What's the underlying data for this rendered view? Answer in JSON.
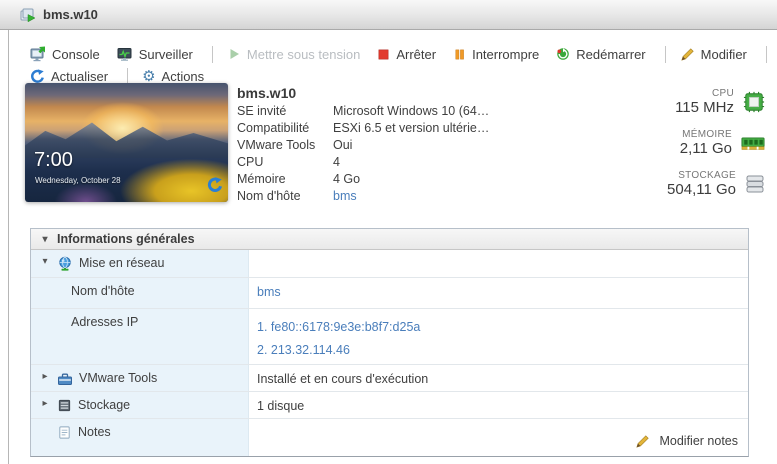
{
  "titlebar": {
    "title": "bms.w10"
  },
  "toolbar": {
    "console": "Console",
    "surveiller": "Surveiller",
    "mettre_sous_tension": "Mettre sous tension",
    "arreter": "Arrêter",
    "interrompre": "Interrompre",
    "redemarrer": "Redémarrer",
    "modifier": "Modifier",
    "actualiser": "Actualiser",
    "actions": "Actions"
  },
  "vm": {
    "name": "bms.w10",
    "thumbnail": {
      "time": "7:00",
      "date": "Wednesday, October 28"
    },
    "details": [
      {
        "label": "SE invité",
        "value": "Microsoft Windows 10 (64…"
      },
      {
        "label": "Compatibilité",
        "value": "ESXi 6.5 et version ultérie…"
      },
      {
        "label": "VMware Tools",
        "value": "Oui"
      },
      {
        "label": "CPU",
        "value": "4"
      },
      {
        "label": "Mémoire",
        "value": "4 Go"
      },
      {
        "label": "Nom d'hôte",
        "value": "bms"
      }
    ],
    "stats": [
      {
        "label": "CPU",
        "value": "115 MHz"
      },
      {
        "label": "MÉMOIRE",
        "value": "2,11 Go"
      },
      {
        "label": "STOCKAGE",
        "value": "504,11 Go"
      }
    ]
  },
  "general_info": {
    "title": "Informations générales",
    "rows": {
      "network": {
        "label": "Mise en réseau",
        "value": ""
      },
      "hostname": {
        "label": "Nom d'hôte",
        "value": "bms"
      },
      "ip": {
        "label": "Adresses IP",
        "lines": [
          "1. fe80::6178:9e3e:b8f7:d25a",
          "2. 213.32.114.46"
        ]
      },
      "tools": {
        "label": "VMware Tools",
        "value": "Installé et en cours d'exécution"
      },
      "storage": {
        "label": "Stockage",
        "value": "1 disque"
      },
      "notes": {
        "label": "Notes",
        "edit_label": "Modifier notes"
      }
    }
  },
  "colors": {
    "link_blue": "#4a7ebb",
    "power_on_green": "#3aa33a",
    "stop_red": "#e23b2e",
    "pause_orange": "#f09a28",
    "refresh_blue": "#2d7dd2",
    "pencil_yellow": "#e3b53a",
    "label_cell_blue": "#e9f3fa"
  }
}
